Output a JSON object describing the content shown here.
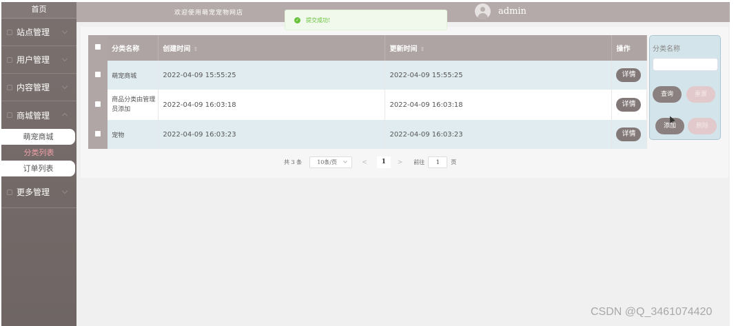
{
  "sidebar": {
    "home": "首页",
    "groups": [
      {
        "label": "站点管理"
      },
      {
        "label": "用户管理"
      },
      {
        "label": "内容管理"
      },
      {
        "label": "商城管理"
      },
      {
        "label": "更多管理"
      }
    ],
    "sub_items": [
      {
        "label": "萌宠商城"
      },
      {
        "label": "分类列表"
      },
      {
        "label": "订单列表"
      }
    ]
  },
  "header": {
    "welcome": "欢迎使用萌宠宠物网店",
    "username": "admin"
  },
  "toast": {
    "message": "提交成功!"
  },
  "table": {
    "columns": [
      "分类名称",
      "创建时间",
      "更新时间",
      "操作"
    ],
    "rows": [
      {
        "name": "萌宠商城",
        "created": "2022-04-09 15:55:25",
        "updated": "2022-04-09 15:55:25",
        "action": "详情"
      },
      {
        "name": "商品分类由管理员添加",
        "created": "2022-04-09 16:03:18",
        "updated": "2022-04-09 16:03:18",
        "action": "详情"
      },
      {
        "name": "宠物",
        "created": "2022-04-09 16:03:23",
        "updated": "2022-04-09 16:03:23",
        "action": "详情"
      }
    ]
  },
  "pagination": {
    "total": "共 3 条",
    "page_size": "10条/页",
    "prev": "<",
    "current": "1",
    "next": ">",
    "goto_label": "前往",
    "goto_value": "1",
    "page_word": "页"
  },
  "search_panel": {
    "label": "分类名称",
    "input_value": "",
    "query_label": "查询",
    "reset_label": "重置",
    "add_label": "添加",
    "delete_label": "删除"
  },
  "watermark": "CSDN @Q_3461074420",
  "colors": {
    "sidebar": "#6e6564",
    "header": "#b4aaa9",
    "table_header": "#aea4a3",
    "button": "#827877",
    "row_alt": "#e1ecf0",
    "success": "#67c23a"
  }
}
